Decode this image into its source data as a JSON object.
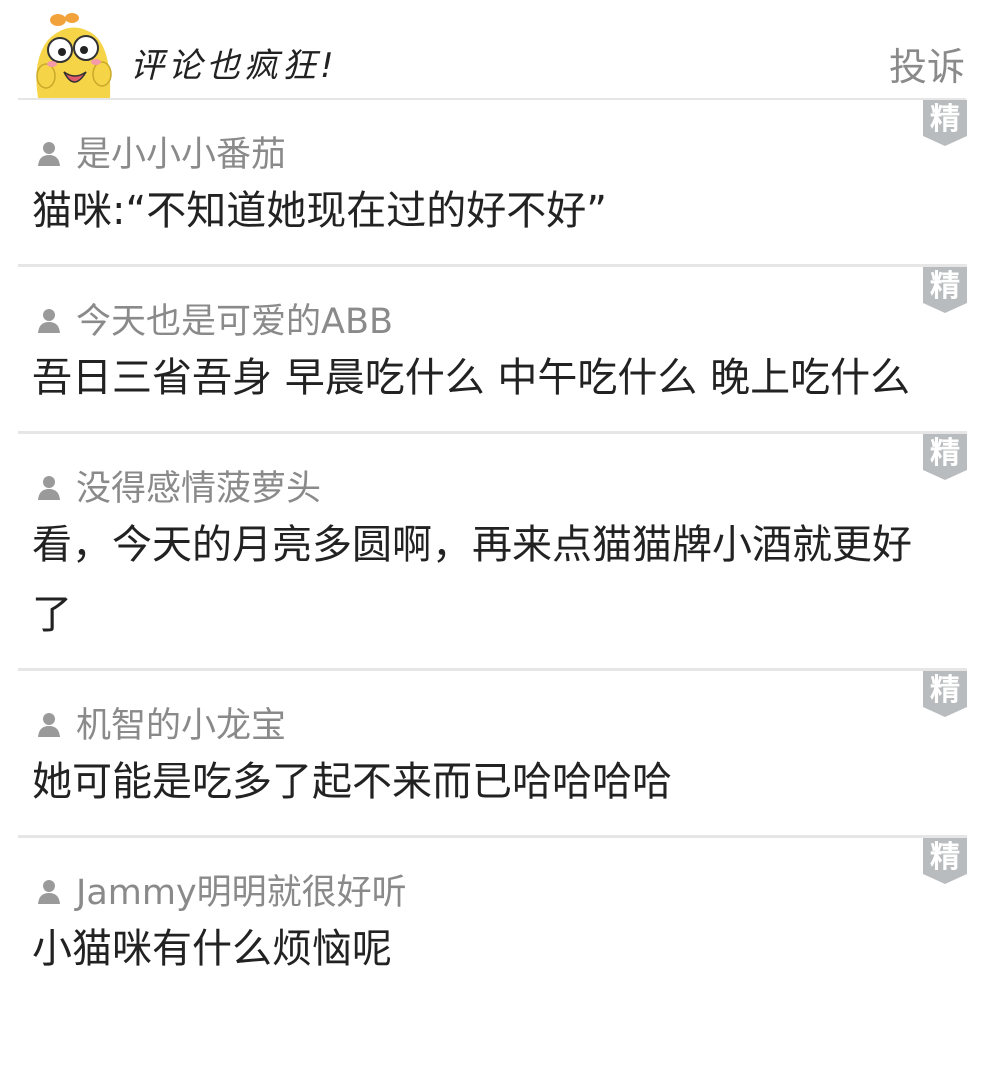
{
  "header": {
    "title": "评论也疯狂!",
    "report_label": "投诉"
  },
  "icons": {
    "mascot": "yellow-cartoon-mascot-icon",
    "user": "user-silhouette-icon",
    "featured": "featured-badge-icon"
  },
  "colors": {
    "badge_bg": "#b9bcbe",
    "muted_text": "#8a8a8a",
    "body_text": "#222222",
    "divider": "#e6e6e6",
    "mascot_yellow": "#f5d547"
  },
  "comments": [
    {
      "username": "是小小小番茄",
      "badge": "精",
      "text": "猫咪:“不知道她现在过的好不好”"
    },
    {
      "username": "今天也是可爱的ABB",
      "badge": "精",
      "text": "吾日三省吾身 早晨吃什么 中午吃什么 晚上吃什么"
    },
    {
      "username": "没得感情菠萝头",
      "badge": "精",
      "text": "看，今天的月亮多圆啊，再来点猫猫牌小酒就更好了"
    },
    {
      "username": "机智的小龙宝",
      "badge": "精",
      "text": "她可能是吃多了起不来而已哈哈哈哈"
    },
    {
      "username": "Jammy明明就很好听",
      "badge": "精",
      "text": "小猫咪有什么烦恼呢"
    }
  ]
}
